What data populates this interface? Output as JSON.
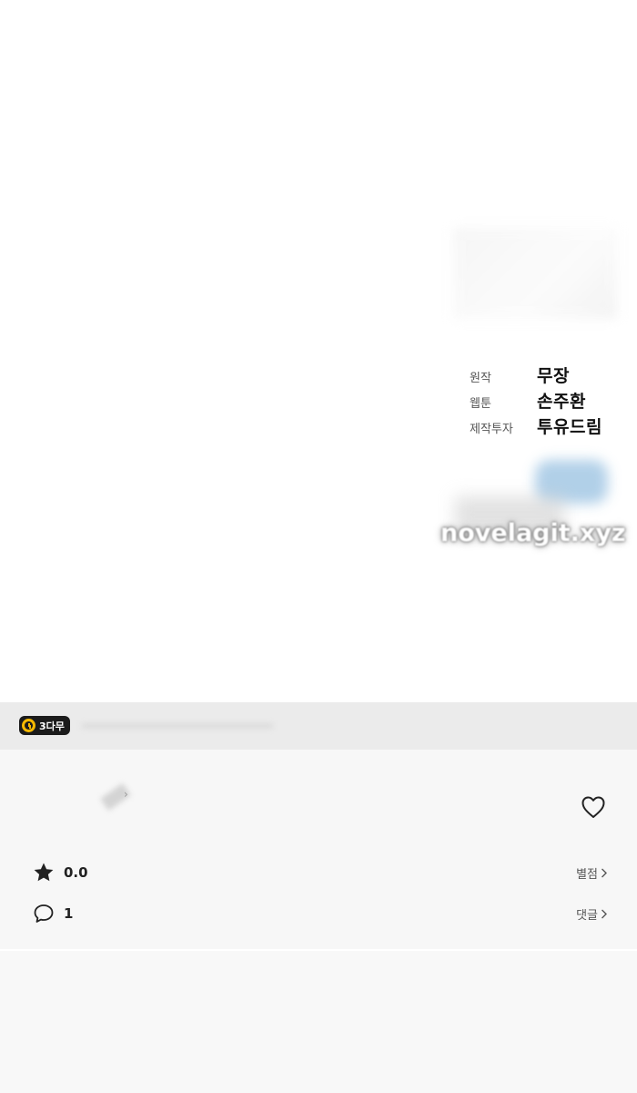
{
  "credits": [
    {
      "role": "원작",
      "name": "무장"
    },
    {
      "role": "웹툰",
      "name": "손주환"
    },
    {
      "role": "제작투자",
      "name": "투유드림"
    }
  ],
  "watermark": "novelagit.xyz",
  "badge": {
    "label": "3다무",
    "icon": "clock-icon",
    "color": "#f5b800"
  },
  "stats": {
    "rating": {
      "value": "0.0",
      "icon": "star-icon",
      "link_label": "별점"
    },
    "comments": {
      "value": "1",
      "icon": "comment-icon",
      "link_label": "댓글"
    }
  },
  "favorite": {
    "icon": "heart-icon"
  },
  "colors": {
    "strip_bg": "#ebebeb",
    "panel_bg": "#f7f7f7",
    "badge_bg": "#1b1b1b"
  }
}
